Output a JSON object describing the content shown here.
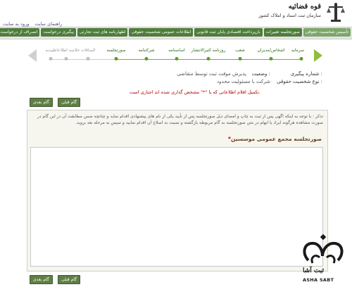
{
  "header": {
    "brand_title": "قوه قضائیه",
    "brand_sub": "سازمان ثبت اسناد و املاک کشور",
    "links": [
      "ورود به سایت",
      "راهنمای سایت"
    ]
  },
  "menu": [
    "تأسیس شخصیت حقوقی",
    "صورتجلسه تغییرات",
    "بازپرداخت اقتصادی پایان ثبت قانونی",
    "اطلاعات عمومی شخصیت حقوقی",
    "اظهارنامه های ثبت تجارتی",
    "پیگیری درخواست",
    "انصراف از درخواست"
  ],
  "steps": [
    {
      "label": "سرمایه",
      "state": "done"
    },
    {
      "label": "اشخاص/مدیران",
      "state": "done"
    },
    {
      "label": "شعب",
      "state": "done"
    },
    {
      "label": "روزنامه کثیرالانتشار",
      "state": "done"
    },
    {
      "label": "اساسنامه",
      "state": "done"
    },
    {
      "label": "شرکتنامه",
      "state": "done"
    },
    {
      "label": "صورتجلسه",
      "state": "done"
    },
    {
      "label": "الصاقات",
      "state": "todo"
    },
    {
      "label": "خلاصه اطلاعات",
      "state": "todo"
    },
    {
      "label": "تاییدیه",
      "state": "todo"
    }
  ],
  "info": {
    "tracking_label": "شماره پیگیری :",
    "status_label": "وضعیت :",
    "status_value": "پذیرش موقت ثبت توسط متقاضی",
    "entity_type_label": "نوع شخصیت حقوقی :",
    "entity_type_value": "شرکت با مسئولیت محدود"
  },
  "notice": "تکمیل اقلام اطلاعاتی که با \"*\" مشخص گذاری شده اند اجباری است.",
  "buttons": {
    "next": "گام بعدی",
    "prev": "گام قبلی"
  },
  "panel": {
    "text": "تذکر : با توجه به اینکه اگهی پس از ثبت به چاپ و امضای ذیل صورتجلسه پس از تأیید یکی از نام های پیشنهادی اقدام نماید و چنانچه ضمن مطابقت آن در این گام در صورت مشاهده هرگونه ایراد یا ابهام در متن صورتجلسه به گام مربوطه بازگشته و نسبت به اصلاح آن اقدام نمایید و سپس به مرحله بعد بروید.",
    "title": "صورتجلسه مجمع عمومی موسسین",
    "required_mark": "*"
  },
  "watermark": {
    "name": "ثبت آشا",
    "sub": "ASHA SABT"
  }
}
